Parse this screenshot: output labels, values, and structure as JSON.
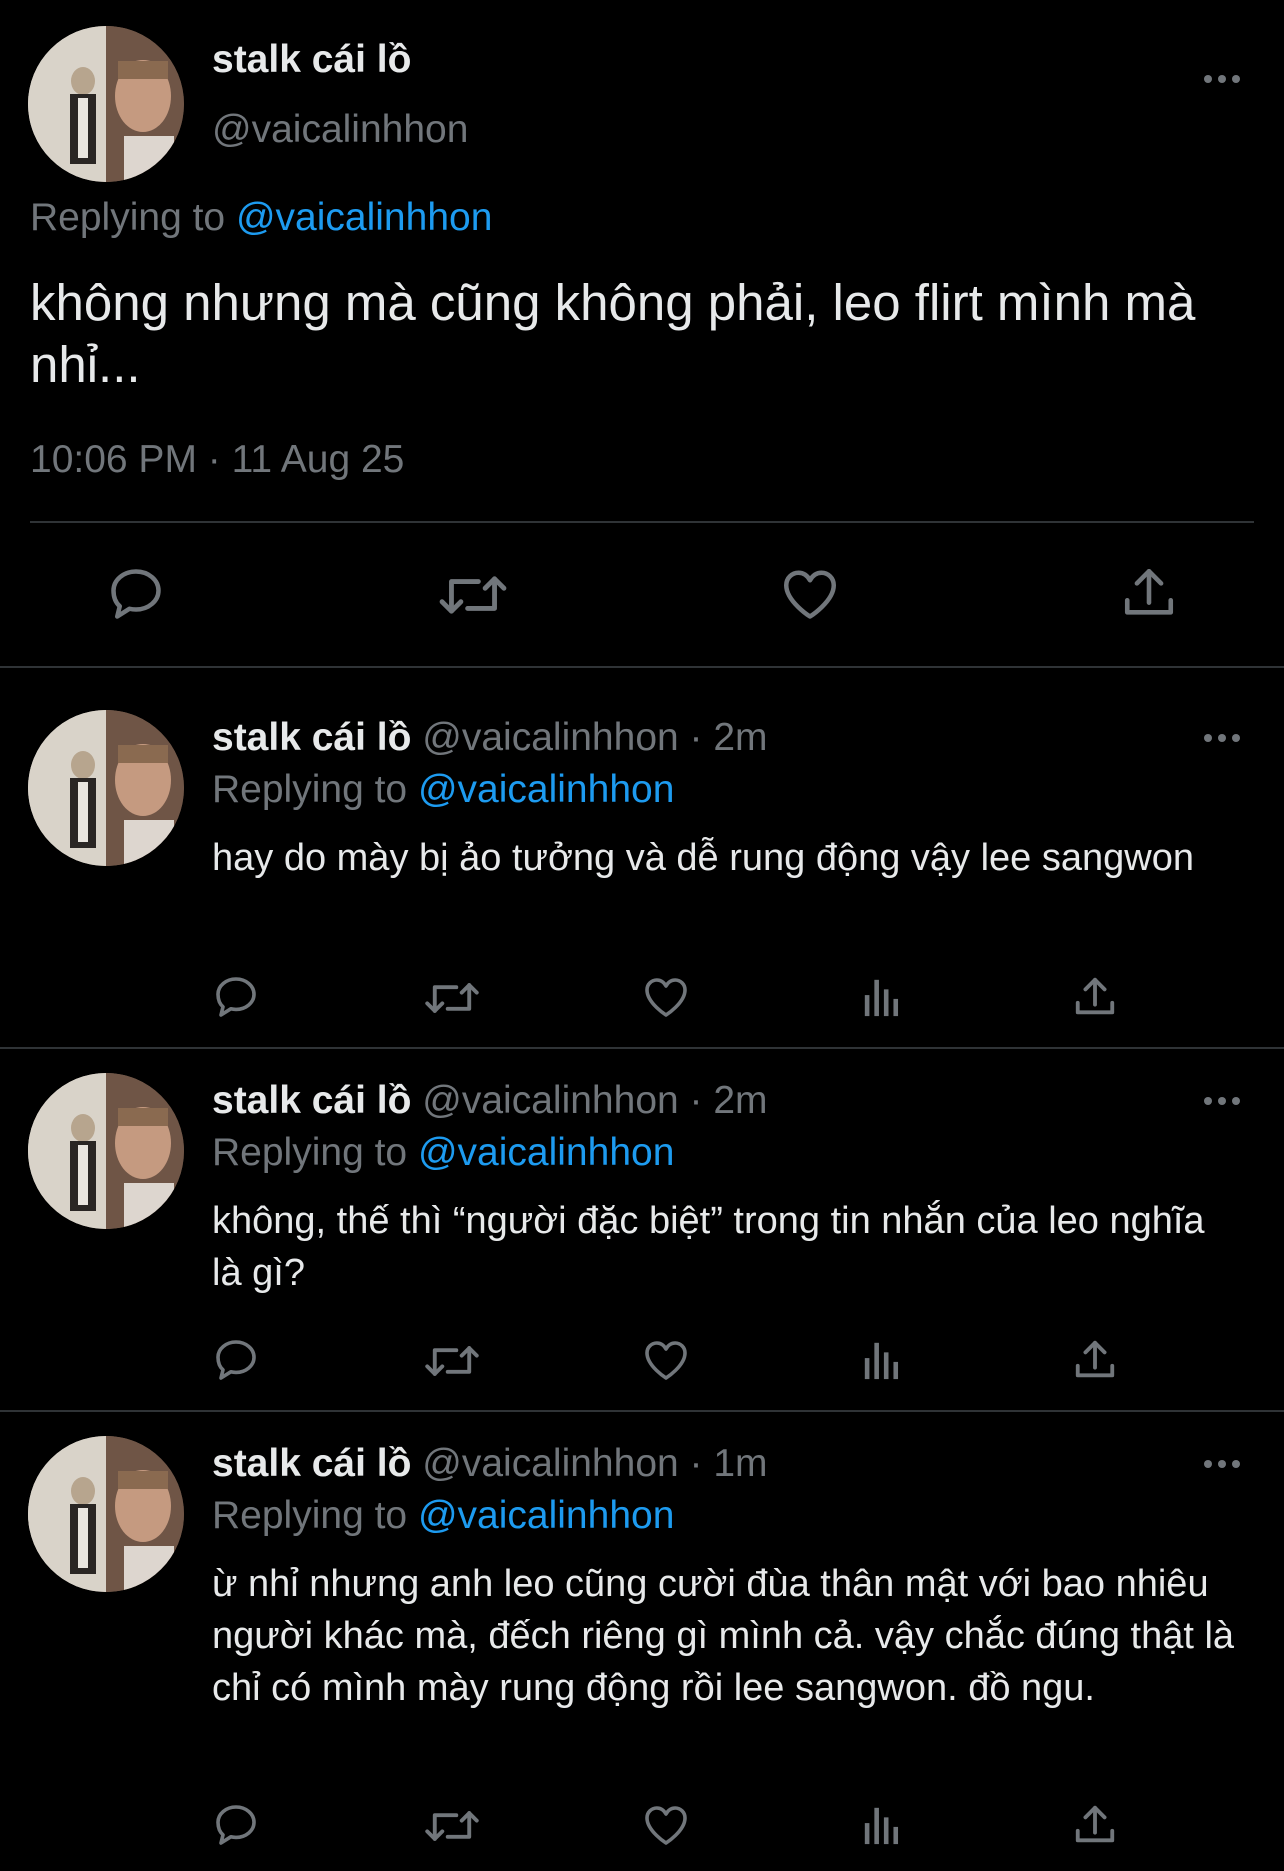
{
  "main_tweet": {
    "display_name": "stalk cái lồ",
    "handle": "@vaicalinhhon",
    "replying_prefix": "Replying to",
    "replying_to": "@vaicalinhhon",
    "text": "không nhưng mà cũng không phải, leo flirt mình mà nhỉ...",
    "timestamp": "10:06 PM · 11 Aug 25",
    "actions": [
      "reply-icon",
      "retweet-icon",
      "like-icon",
      "share-icon"
    ]
  },
  "replies": [
    {
      "display_name": "stalk cái lồ",
      "meta": "@vaicalinhhon · 2m",
      "replying_prefix": "Replying to",
      "replying_to": "@vaicalinhhon",
      "text": "hay do mày bị ảo tưởng và dễ rung động vậy lee sangwon"
    },
    {
      "display_name": "stalk cái lồ",
      "meta": "@vaicalinhhon · 2m",
      "replying_prefix": "Replying to",
      "replying_to": "@vaicalinhhon",
      "text": "không, thế thì “người đặc biệt” trong tin nhắn của leo nghĩa là gì?"
    },
    {
      "display_name": "stalk cái lồ",
      "meta": "@vaicalinhhon · 1m",
      "replying_prefix": "Replying to",
      "replying_to": "@vaicalinhhon",
      "text": "ừ nhỉ nhưng anh leo cũng cười đùa thân mật với bao nhiêu người khác mà, đếch riêng gì mình cả. vậy chắc đúng thật là chỉ có mình mày rung động rồi lee sangwon. đồ ngu."
    }
  ],
  "colors": {
    "background": "#000000",
    "text": "#e7e9ea",
    "muted": "#71767b",
    "link": "#1d9bf0",
    "divider": "#2f3336"
  }
}
